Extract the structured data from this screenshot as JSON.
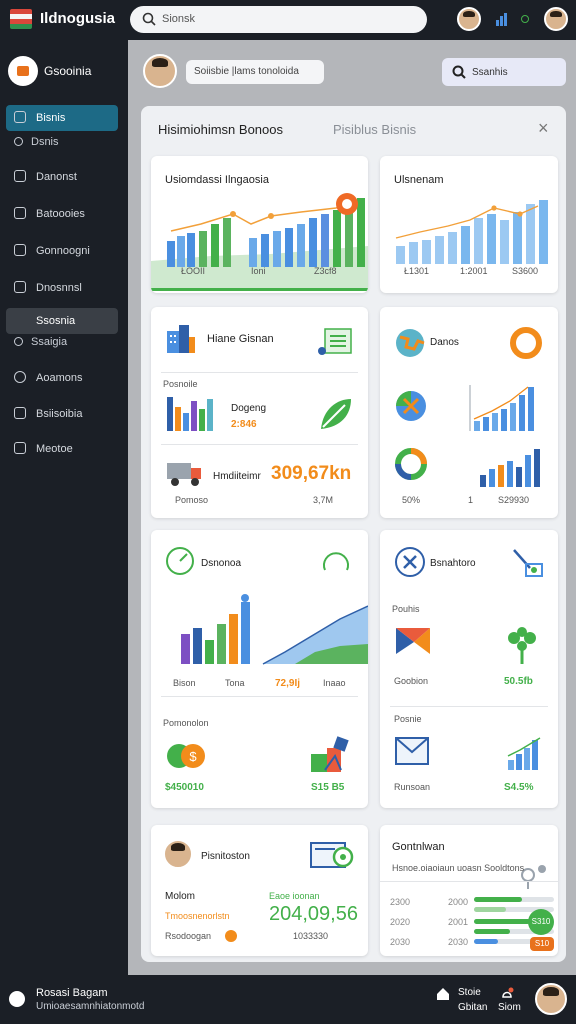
{
  "app": {
    "brand": "Ildnogusia",
    "search_placeholder": "Sionsk"
  },
  "sidebar": {
    "brand": "Gsooinia",
    "items": [
      {
        "label": "Bisnis",
        "sub": "Dsnis"
      },
      {
        "label": "Danonst"
      },
      {
        "label": "Batoooies"
      },
      {
        "label": "Gonnoogni"
      },
      {
        "label": "Dnosnnsl"
      },
      {
        "label": "Ssosnia",
        "sub": "Ssaigia"
      },
      {
        "label": "Aoamons"
      },
      {
        "label": "Bsiisoibia"
      },
      {
        "label": "Meotoe"
      }
    ]
  },
  "header": {
    "chip": "Soiisbie |lams tonoloida",
    "search_btn": "Ssanhis"
  },
  "panel": {
    "title": "Hisimiohimsn Bonoos",
    "tab": "Pisiblus  Bisnis",
    "close": "×",
    "card1": {
      "title": "Usiomdassi Ilngaosia",
      "labels": [
        "ŁOOII",
        "Ioni",
        "Z3cf8"
      ]
    },
    "card2": {
      "title": "Ulsnenam",
      "labels": [
        "Ł1301",
        "1:2001",
        "S3600"
      ]
    },
    "card3": {
      "title": "Hiane Gisnan",
      "section": "Posnoile",
      "item1": "Dogeng",
      "item1_value": "2:846",
      "item2": "Hmdiiteimr",
      "item2_value": "309,67kn",
      "footer_label": "Pomoso",
      "footer_value": "3,7M"
    },
    "card4": {
      "title": "Danos",
      "values": [
        "50%",
        "1",
        "S29930"
      ]
    },
    "card5": {
      "title": "Dsnonoa",
      "labels": [
        "Bison",
        "Tona",
        "72,9Ij",
        "Inaao"
      ],
      "section": "Pomonolon",
      "value": "$450010",
      "value2": "S15 B5"
    },
    "card6": {
      "title": "Bsnahtoro",
      "section": "Pouhis",
      "label": "Goobion",
      "value": "50.5fb",
      "section2": "Posnie",
      "label2": "Runsoan",
      "value2": "S4.5%"
    },
    "card7": {
      "title": "Pisnitoston",
      "label": "Molom",
      "sub": "Tmoosnenorlstn",
      "label2": "Rsodoogan",
      "value_label": "Eaoe ioonan",
      "value": "204,09,56",
      "value_sub": "1033330"
    },
    "card8": {
      "title": "Gontnlwan",
      "sub": "Hsnoe.oiaoiaun uoasn Sooldtons",
      "rows": [
        {
          "a": "2300",
          "b": "2000"
        },
        {
          "a": "2020",
          "b": "2001"
        },
        {
          "a": "2030",
          "b": "2030"
        }
      ],
      "badge1": "S310",
      "badge2": "S10"
    }
  },
  "footer": {
    "title": "Rosasi Bagam",
    "sub": "Umioaesamnhiatonmotd",
    "item1": "Stoie",
    "item1_sub": "Gbitan",
    "item2": "Siom"
  },
  "colors": {
    "accent": "#1d6a86",
    "green": "#43b04a",
    "orange": "#f28c1b",
    "blue": "#4a8fe0"
  }
}
